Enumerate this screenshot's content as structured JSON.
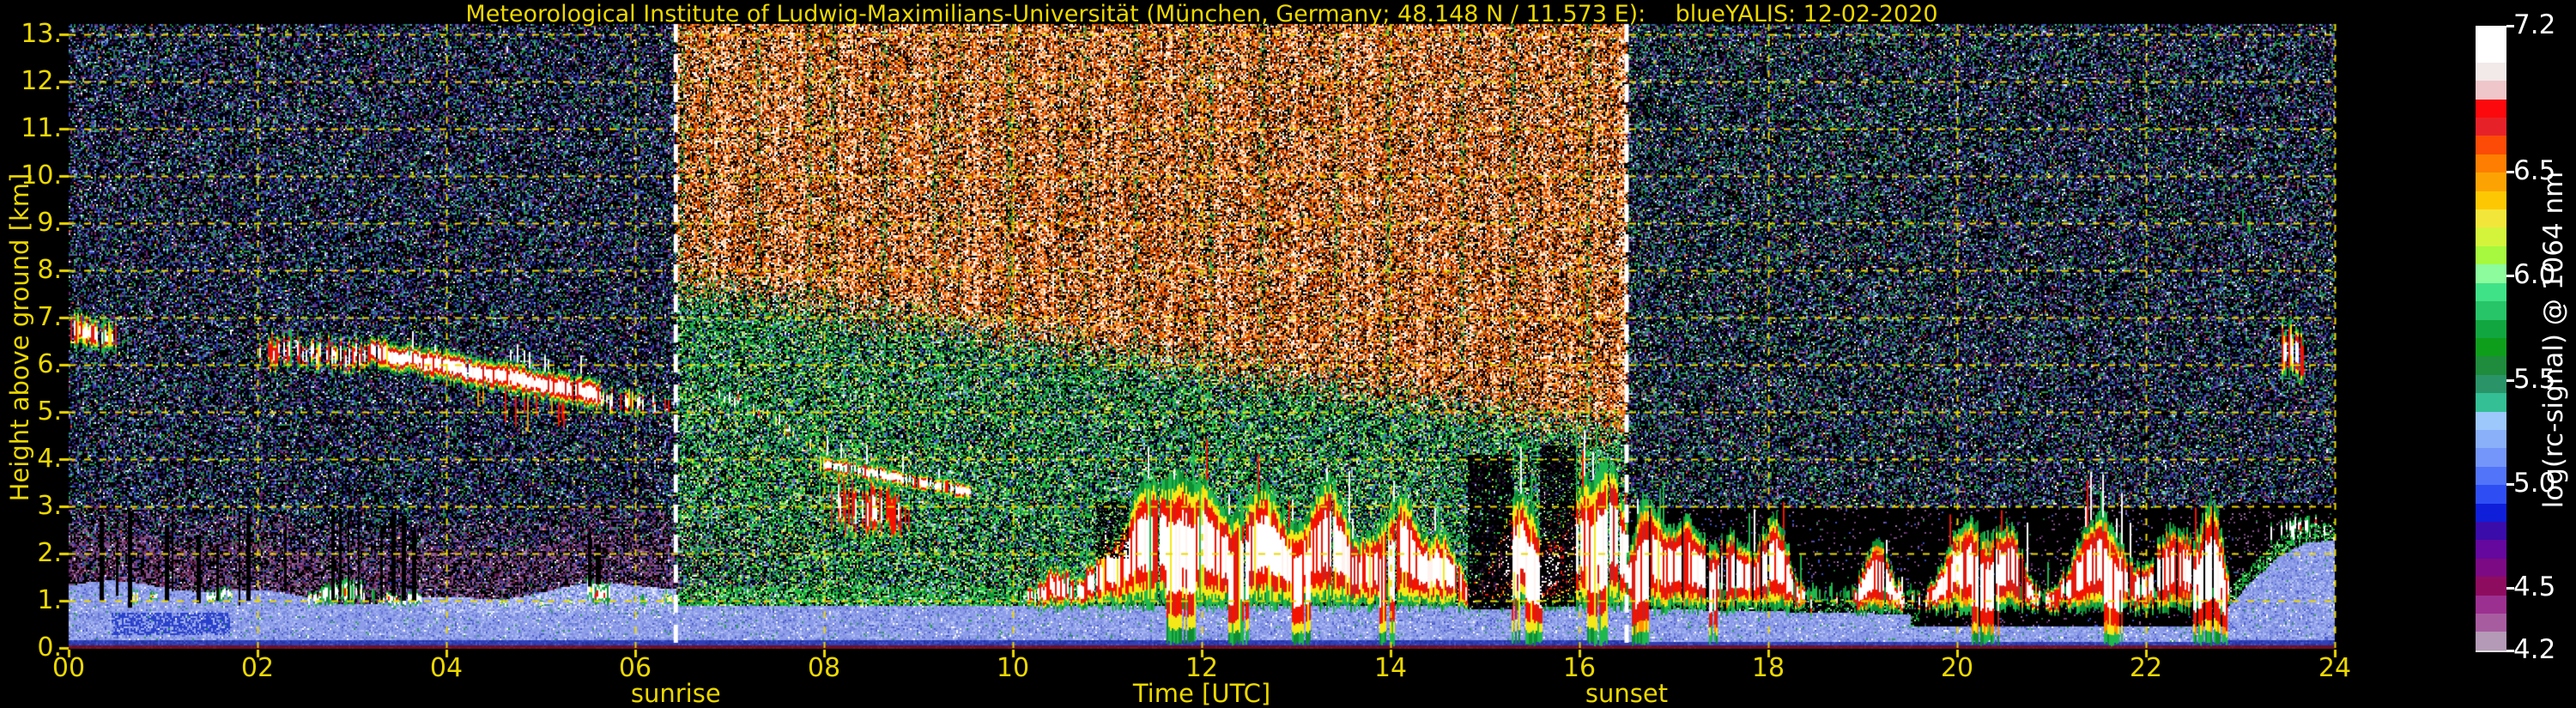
{
  "chart_data": {
    "type": "heatmap",
    "title": "Meteorological Institute of Ludwig-Maximilians-Universität (München, Germany; 48.148 N / 11.573 E):    blueYALIS: 12-02-2020",
    "xlabel": "Time [UTC]",
    "ylabel": "Height above ground [km]",
    "x_range_hours": [
      0,
      24
    ],
    "y_range_km": [
      0,
      13.2
    ],
    "grid": true,
    "grid_color": "#ecd800",
    "axis_text_color": "#ecd800",
    "x_ticks": [
      "00",
      "02",
      "04",
      "06",
      "08",
      "10",
      "12",
      "14",
      "16",
      "18",
      "20",
      "22",
      "24"
    ],
    "y_ticks": [
      "0.",
      "1.",
      "2.",
      "3.",
      "4.",
      "5.",
      "6.",
      "7.",
      "8.",
      "9.",
      "10.",
      "11.",
      "12.",
      "13."
    ],
    "annotations": [
      {
        "label": "sunrise",
        "time_utc": 6.43,
        "line_color": "#ffffff",
        "line_style": "dashed"
      },
      {
        "label": "sunset",
        "time_utc": 16.5,
        "line_color": "#ffffff",
        "line_style": "dashed"
      }
    ],
    "colorbar": {
      "label": "log(rc-signal) @ 1064 nm",
      "range": [
        4.2,
        7.2
      ],
      "tick_values": [
        7.2,
        6.5,
        6.0,
        5.5,
        5.0,
        4.5,
        4.2
      ],
      "tick_labels": [
        "7.2",
        "6.5",
        "6.0",
        "5.5",
        "5.0",
        "4.5",
        "4.2"
      ],
      "colors": [
        "#ffffff",
        "#ffffff",
        "#f2e9e9",
        "#efc6ca",
        "#fb090c",
        "#e62228",
        "#fb4b06",
        "#fd7e00",
        "#fca303",
        "#fdc803",
        "#f3e63a",
        "#d4f43c",
        "#a6f93e",
        "#8cfc9c",
        "#40e288",
        "#28c468",
        "#12a640",
        "#0f9e1c",
        "#1e8c3c",
        "#2a9468",
        "#34bf95",
        "#9cc8fc",
        "#8ab0fa",
        "#7496fa",
        "#5274f8",
        "#2e4ef4",
        "#0f1ed8",
        "#3a0caa",
        "#64089e",
        "#7c0a84",
        "#8e0c60",
        "#9c3090",
        "#a85ca0",
        "#b49ab6"
      ]
    },
    "palettes": {
      "noise": {
        "night_high": [
          [
            "#000000",
            46
          ],
          [
            "#13134f",
            9
          ],
          [
            "#262a8c",
            6
          ],
          [
            "#3c50c8",
            4
          ],
          [
            "#8098e0",
            3
          ],
          [
            "#1e8c46",
            11
          ],
          [
            "#2aa070",
            5
          ],
          [
            "#59bd8e",
            2
          ],
          [
            "#6a2a78",
            5
          ],
          [
            "#8c4890",
            2
          ],
          [
            "#70103c",
            2
          ],
          [
            "#a8c4f0",
            2
          ],
          [
            "#ffffff",
            1
          ],
          [
            "#c8d800",
            1
          ],
          [
            "#e06020",
            1
          ]
        ],
        "night_high_blue": [
          [
            "#000000",
            48
          ],
          [
            "#13134f",
            12
          ],
          [
            "#2a3ab0",
            8
          ],
          [
            "#3c50c8",
            5
          ],
          [
            "#8098e0",
            4
          ],
          [
            "#1e8c46",
            6
          ],
          [
            "#2aa070",
            3
          ],
          [
            "#6a2a78",
            6
          ],
          [
            "#8c4890",
            3
          ],
          [
            "#70103c",
            2
          ],
          [
            "#a8c4f0",
            2
          ],
          [
            "#ffffff",
            1
          ]
        ],
        "night_purple": [
          [
            "#000000",
            40
          ],
          [
            "#7a4880",
            16
          ],
          [
            "#8c5890",
            9
          ],
          [
            "#5a2060",
            8
          ],
          [
            "#6a1838",
            7
          ],
          [
            "#2838a0",
            5
          ],
          [
            "#a878b0",
            5
          ],
          [
            "#3c50c8",
            3
          ],
          [
            "#1e7a3c",
            3
          ],
          [
            "#c8a0c8",
            2
          ],
          [
            "#ffffff",
            1
          ]
        ],
        "purple_dots": [
          [
            "#7a4880",
            40
          ],
          [
            "#8c5890",
            25
          ],
          [
            "#5a2060",
            15
          ],
          [
            "#a878b0",
            10
          ],
          [
            "#3c50c8",
            5
          ],
          [
            "#1e7a3c",
            5
          ]
        ],
        "bl_blue": [
          [
            "#8c9ce8",
            46
          ],
          [
            "#a0b0f0",
            18
          ],
          [
            "#7888dc",
            14
          ],
          [
            "#b8c4f4",
            9
          ],
          [
            "#6474d4",
            6
          ],
          [
            "#ffffff",
            2
          ],
          [
            "#2c9c50",
            2
          ],
          [
            "#4858cc",
            3
          ]
        ],
        "blue_band": [
          [
            "#3040b8",
            60
          ],
          [
            "#2433a0",
            25
          ],
          [
            "#4458d0",
            15
          ]
        ],
        "green_fringe": [
          [
            "#1eb43c",
            40
          ],
          [
            "#0f8c32",
            20
          ],
          [
            "#96f096",
            15
          ],
          [
            "#28cc50",
            10
          ],
          [
            "#000000",
            10
          ],
          [
            "#ffffff",
            5
          ]
        ],
        "day_green": [
          [
            "#000000",
            30
          ],
          [
            "#1eb43c",
            15
          ],
          [
            "#28cc50",
            8
          ],
          [
            "#147a2a",
            10
          ],
          [
            "#96f096",
            5
          ],
          [
            "#d8e83c",
            5
          ],
          [
            "#f0f060",
            2
          ],
          [
            "#4868d8",
            6
          ],
          [
            "#9cb4f0",
            4
          ],
          [
            "#16165a",
            8
          ],
          [
            "#ffffff",
            2
          ],
          [
            "#ff6030",
            1
          ],
          [
            "#2aa070",
            4
          ]
        ],
        "day_orange": [
          [
            "#000000",
            26
          ],
          [
            "#8c2000",
            7
          ],
          [
            "#c83c00",
            13
          ],
          [
            "#e85c00",
            12
          ],
          [
            "#f08020",
            10
          ],
          [
            "#ffb060",
            9
          ],
          [
            "#ffd8b0",
            8
          ],
          [
            "#ffffff",
            8
          ],
          [
            "#ffe8d8",
            3
          ],
          [
            "#3c8c3c",
            3
          ],
          [
            "#f5d800",
            1
          ]
        ],
        "day_orange_bright": [
          [
            "#000000",
            16
          ],
          [
            "#c83c00",
            10
          ],
          [
            "#e85c00",
            12
          ],
          [
            "#f08020",
            13
          ],
          [
            "#ffb060",
            12
          ],
          [
            "#ffd8b0",
            12
          ],
          [
            "#ffffff",
            14
          ],
          [
            "#ffe8d8",
            6
          ],
          [
            "#8c2000",
            4
          ],
          [
            "#f5d800",
            1
          ]
        ],
        "day_orange_green": [
          [
            "#000000",
            28
          ],
          [
            "#3c8c3c",
            14
          ],
          [
            "#2aa050",
            8
          ],
          [
            "#c8c83c",
            8
          ],
          [
            "#c83c00",
            10
          ],
          [
            "#e85c00",
            8
          ],
          [
            "#f08020",
            7
          ],
          [
            "#ffb060",
            6
          ],
          [
            "#ffd8b0",
            5
          ],
          [
            "#ffffff",
            5
          ],
          [
            "#147a2a",
            1
          ]
        ],
        "light_patch": [
          [
            "#c8d4f8",
            50
          ],
          [
            "#dce4fa",
            25
          ],
          [
            "#aab8f0",
            25
          ]
        ]
      },
      "cloud": {
        "green": "#1fb84e",
        "green2": "#0f8c32",
        "yellow": "#f5e818",
        "orange": "#ff9000",
        "red": "#f21400",
        "red2": "#cc2020",
        "white": "#ffffff",
        "pale": "#fff2ee"
      },
      "surface_line": "#6b1028"
    },
    "features": [
      {
        "kind": "streak_cloud",
        "label": "cloud fragments 00:00-00:30 UTC at 6.3-7.1 km",
        "t0": 0.02,
        "t1": 0.5,
        "top0": 7.05,
        "top1": 6.8,
        "bot0": 6.4,
        "bot1": 6.3,
        "fill": 0.72,
        "pw": 0.5,
        "pr": 0.55,
        "py": 0.75,
        "jit": 0.15
      },
      {
        "kind": "streak_cloud",
        "label": "cloud streaks 02:00-03:10 UTC at 5.9-6.6 km",
        "t0": 2.0,
        "t1": 3.18,
        "top0": 6.6,
        "top1": 6.5,
        "bot0": 5.95,
        "bot1": 5.9,
        "fill": 0.6,
        "pw": 0.6,
        "pr": 0.85,
        "py": 0.8,
        "jit": 0.18
      },
      {
        "kind": "band_cloud",
        "label": "dense mid-level cloud 03:10-05:40 UTC descending 6.3 to 5.3 km",
        "t0": 3.18,
        "t1": 5.62,
        "c0": 6.28,
        "c1": 5.35,
        "half": 0.3,
        "fill": 0.97,
        "pw": 0.9,
        "pr": 0.95,
        "py": 0.9,
        "jit": 0.1,
        "spikes": [
          4.25,
          5.35
        ]
      },
      {
        "kind": "streak_cloud",
        "label": "thinning cloud 05:40-06:25 UTC near 5 km",
        "t0": 5.62,
        "t1": 6.42,
        "top0": 5.5,
        "top1": 5.3,
        "bot0": 5.05,
        "bot1": 4.95,
        "fill": 0.45,
        "pw": 0.5,
        "pr": 0.7,
        "py": 0.7,
        "jit": 0.12
      },
      {
        "kind": "blob_trail",
        "label": "descending fragments 07:00-07:50 UTC 5.4 to 4.4 km",
        "t0": 6.88,
        "t1": 7.85,
        "c0": 5.4,
        "c1": 4.4,
        "size": 0.2,
        "fill": 0.32
      },
      {
        "kind": "band_cloud",
        "label": "descending layer 08:00-09:30 UTC 3.9 to 3.3 km",
        "t0": 7.95,
        "t1": 9.55,
        "c0": 3.92,
        "c1": 3.3,
        "half": 0.17,
        "fill": 0.88,
        "pw": 0.85,
        "pr": 0.7,
        "py": 0.9,
        "jit": 0.1
      },
      {
        "kind": "streak_cloud",
        "label": "red virga 08:00-08:55 UTC 2.4-3.6 km",
        "t0": 8.05,
        "t1": 8.9,
        "top0": 3.65,
        "top1": 3.2,
        "bot0": 2.5,
        "bot1": 2.4,
        "fill": 0.72,
        "pw": 0.25,
        "pr": 1.0,
        "py": 0.85,
        "jit": 0.25,
        "redHeavy": true
      },
      {
        "kind": "cumulus_field",
        "label": "daytime boundary-layer clouds 10:10-16:30 UTC 1-3.6 km",
        "t0": 10.15,
        "t1": 16.5,
        "base": 1.15,
        "bot": 0.78,
        "gap": 0.05,
        "redHeavy": false,
        "bumps": [
          [
            10.45,
            0.55,
            0.18
          ],
          [
            10.95,
            0.85,
            0.25
          ],
          [
            11.4,
            2.3,
            0.28
          ],
          [
            11.75,
            1.5,
            0.2
          ],
          [
            12.05,
            2.1,
            0.25
          ],
          [
            12.45,
            1.4,
            0.22
          ],
          [
            12.7,
            1.7,
            0.2
          ],
          [
            13.05,
            1.2,
            0.25
          ],
          [
            13.35,
            2.0,
            0.22
          ],
          [
            13.8,
            1.1,
            0.3
          ],
          [
            14.15,
            1.8,
            0.22
          ],
          [
            14.55,
            1.2,
            0.2
          ],
          [
            15.35,
            2.1,
            0.3
          ],
          [
            16.0,
            2.2,
            0.28
          ],
          [
            16.35,
            2.3,
            0.2
          ]
        ],
        "plumes": [
          [
            11.62,
            11.92
          ],
          [
            12.28,
            12.5
          ],
          [
            12.95,
            13.15
          ],
          [
            13.85,
            14.05
          ],
          [
            15.28,
            15.6
          ],
          [
            16.08,
            16.3
          ]
        ]
      },
      {
        "kind": "cumulus_field",
        "label": "evening clouds 16:30-22:50 UTC 1-3.3 km",
        "t0": 16.5,
        "t1": 22.88,
        "base": 1.0,
        "bot": 0.7,
        "gap": 0.12,
        "redHeavy": true,
        "bumps": [
          [
            16.7,
            2.1,
            0.22
          ],
          [
            17.15,
            1.7,
            0.25
          ],
          [
            17.6,
            1.4,
            0.2
          ],
          [
            18.05,
            1.8,
            0.22
          ],
          [
            19.15,
            1.2,
            0.2
          ],
          [
            20.1,
            1.7,
            0.3
          ],
          [
            20.55,
            1.4,
            0.2
          ],
          [
            21.5,
            1.8,
            0.35
          ],
          [
            22.3,
            1.6,
            0.3
          ],
          [
            22.7,
            1.9,
            0.15
          ]
        ],
        "plumes": [
          [
            16.55,
            16.75
          ],
          [
            17.3,
            17.45
          ],
          [
            20.15,
            20.45
          ],
          [
            21.55,
            21.75
          ],
          [
            22.5,
            22.85
          ]
        ]
      },
      {
        "kind": "bl_blobs",
        "label": "shallow cloud bits atop nocturnal layer 00:40-06:20 UTC",
        "blobs": [
          [
            0.68,
            1.05,
            0.3
          ],
          [
            0.9,
            1.1,
            0.15
          ],
          [
            1.52,
            1.1,
            0.25
          ],
          [
            1.66,
            1.15,
            0.3
          ],
          [
            2.6,
            1.05,
            0.3
          ],
          [
            2.76,
            1.15,
            0.45
          ],
          [
            2.9,
            1.2,
            0.5
          ],
          [
            3.05,
            1.15,
            0.45
          ],
          [
            3.2,
            1.1,
            0.35
          ],
          [
            3.36,
            1.05,
            0.3
          ],
          [
            3.5,
            1.0,
            0.25
          ],
          [
            3.66,
            1.05,
            0.3
          ],
          [
            4.6,
            0.95,
            0.15
          ],
          [
            5.0,
            0.95,
            0.12
          ],
          [
            5.3,
            0.97,
            0.15
          ],
          [
            5.55,
            1.25,
            0.5
          ],
          [
            5.64,
            1.15,
            0.4
          ],
          [
            6.1,
            1.0,
            0.2
          ],
          [
            6.32,
            1.05,
            0.25
          ]
        ]
      },
      {
        "kind": "dropouts",
        "label": "black signal dropout columns 00:00-05:40 UTC",
        "cols": [
          [
            0.33,
            2.8,
            1.0
          ],
          [
            0.5,
            2.2,
            1.1
          ],
          [
            0.63,
            2.9,
            0.85
          ],
          [
            1.02,
            2.6,
            1.0
          ],
          [
            1.09,
            2.9,
            1.2
          ],
          [
            1.35,
            2.4,
            0.95
          ],
          [
            1.56,
            2.2,
            1.0
          ],
          [
            1.8,
            2.9,
            0.9
          ],
          [
            1.88,
            2.85,
            1.0
          ],
          [
            2.28,
            2.5,
            1.2
          ],
          [
            2.78,
            3.0,
            1.0
          ],
          [
            2.86,
            2.95,
            1.1
          ],
          [
            2.95,
            2.9,
            1.0
          ],
          [
            3.06,
            2.9,
            1.1
          ],
          [
            3.3,
            2.6,
            1.0
          ],
          [
            3.42,
            2.9,
            1.1
          ],
          [
            3.53,
            2.8,
            1.0
          ],
          [
            3.64,
            2.5,
            1.0
          ],
          [
            5.5,
            2.45,
            1.3
          ],
          [
            5.58,
            2.2,
            1.35
          ]
        ]
      },
      {
        "kind": "dark_patch",
        "label": "attenuated dark region ~15:00 UTC",
        "t0": 14.82,
        "t1": 15.28,
        "h0": 0.85,
        "h1": 4.1,
        "density": 0.85
      },
      {
        "kind": "dark_patch",
        "label": "attenuated dark region ~15:45 UTC",
        "t0": 15.58,
        "t1": 15.95,
        "h0": 0.9,
        "h1": 4.3,
        "density": 0.8
      },
      {
        "kind": "dark_patch",
        "label": "gaps between cloud towers ~11:00 UTC",
        "t0": 10.88,
        "t1": 11.22,
        "h0": 1.9,
        "h1": 3.1,
        "density": 0.55
      },
      {
        "kind": "streak_cloud",
        "label": "cloud 23:25-23:40 UTC 5.6-6.9 km",
        "t0": 23.42,
        "t1": 23.66,
        "top0": 6.9,
        "top1": 6.6,
        "bot0": 5.8,
        "bot1": 5.6,
        "fill": 0.6,
        "pw": 0.55,
        "pr": 0.85,
        "py": 0.8,
        "jit": 0.2
      },
      {
        "kind": "blob_trail",
        "label": "green wisp ~23:05 UTC 8.7-9.2 km",
        "t0": 23.02,
        "t1": 23.12,
        "c0": 9.1,
        "c1": 8.8,
        "size": 0.18,
        "fill": 0.4,
        "greenOnly": true
      },
      {
        "kind": "blob_trail",
        "label": "cloud caps over late-night aerosol layer 23:20-24:00 UTC",
        "t0": 23.3,
        "t1": 23.98,
        "c0": 2.55,
        "c1": 2.6,
        "size": 0.22,
        "fill": 0.3
      }
    ]
  }
}
